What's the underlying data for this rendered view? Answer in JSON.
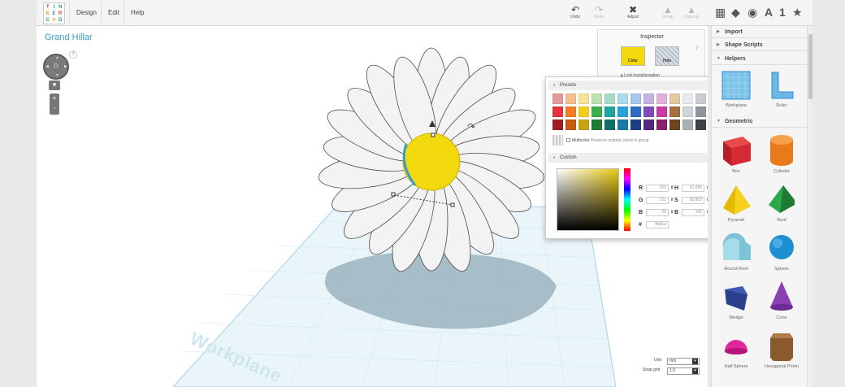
{
  "app": {
    "logo_letters": [
      "T",
      "I",
      "N",
      "K",
      "E",
      "R",
      "C",
      "A",
      "D"
    ]
  },
  "menu": {
    "design": "Design",
    "edit": "Edit",
    "help": "Help"
  },
  "toolbar": {
    "undo": "Undo",
    "redo": "Redo",
    "adjust": "Adjust",
    "group": "Group",
    "ungroup": "Ungroup"
  },
  "view_icons": {
    "a_label": "A",
    "one_label": "1"
  },
  "design": {
    "title": "Grand Hillar",
    "help_label": "?",
    "workplane_label": "Workplane"
  },
  "inspector": {
    "title": "Inspector",
    "color_label": "Color",
    "hole_label": "Hole",
    "help_label": "?",
    "lock_label": "Lock transformation",
    "active_color": "#f2d90e"
  },
  "color_picker": {
    "presets_label": "Presets",
    "multicolor_label": "Multicolor",
    "multicolor_hint": "Preserve original colors in group",
    "custom_label": "Custom",
    "presets": [
      "#e59a9a",
      "#f5c08f",
      "#f7e39a",
      "#bfe0b0",
      "#a8dcc9",
      "#a8dcec",
      "#a9c7ec",
      "#c4b3e0",
      "#e3b1d8",
      "#e6c7a4",
      "#e9ecee",
      "#c9cdd1",
      "#e5323c",
      "#f27d22",
      "#f2cf1a",
      "#3cae4b",
      "#1ea5a0",
      "#2aa3dd",
      "#2e6bc6",
      "#7f4bb8",
      "#c93ba2",
      "#a5703c",
      "#cfd4d8",
      "#8f969c",
      "#9e1d24",
      "#c85a12",
      "#c9a30f",
      "#1f7a33",
      "#0f6e6b",
      "#1c7aa8",
      "#1d3f86",
      "#55287f",
      "#8d1f6e",
      "#6e4420",
      "#aab1b6",
      "#3d4247"
    ],
    "fields": {
      "r_label": "R",
      "r": "255",
      "g_label": "G",
      "g": "221",
      "b_label": "B",
      "b": "26",
      "h_label": "H",
      "h": "51.095",
      "s_label": "S",
      "s": "89.803",
      "v_label": "B",
      "v": "100",
      "hex_label": "#",
      "hex": "ffdd1a"
    }
  },
  "grid_settings": {
    "unit_label": "Unit",
    "unit": "mm",
    "snap_label": "Snap grid",
    "snap": "1.0"
  },
  "sidebar": {
    "import": "Import",
    "shape_scripts": "Shape Scripts",
    "helpers": "Helpers",
    "geometric": "Geometric",
    "helper_items": [
      "Workplane",
      "Ruler"
    ],
    "shapes": [
      "Box",
      "Cylinder",
      "Pyramid",
      "Roof",
      "Round Roof",
      "Sphere",
      "Wedge",
      "Cone",
      "Half Sphere",
      "Hexagonal Prism"
    ]
  }
}
